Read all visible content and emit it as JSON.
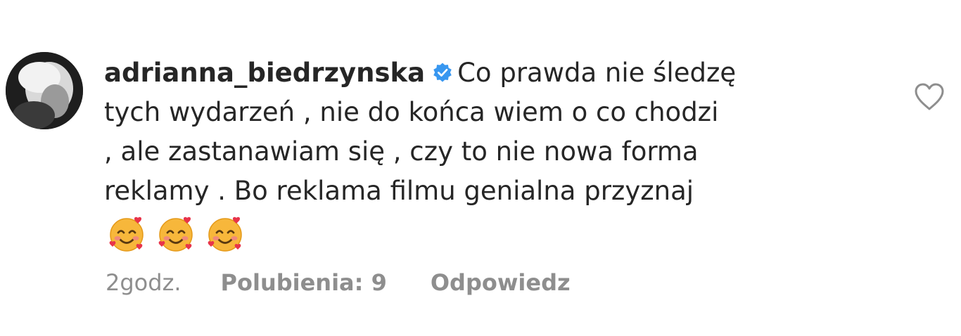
{
  "comment": {
    "username": "adrianna_biedrzynska",
    "verified": true,
    "text": "Co prawda nie śledzę\ntych wydarzeń , nie do końca wiem o co chodzi\n, ale zastanawiam się , czy to nie nowa forma\nreklamy . Bo reklama filmu genialna przyznaj",
    "emojis": [
      "🥰",
      "🥰",
      "🥰"
    ],
    "time": "2godz.",
    "likes_label": "Polubienia: 9",
    "reply_label": "Odpowiedz"
  },
  "icons": {
    "verified": "verified-badge-icon",
    "like": "heart-outline-icon"
  },
  "colors": {
    "text": "#262626",
    "muted": "#8e8e8e",
    "verified_blue": "#3897f0"
  }
}
